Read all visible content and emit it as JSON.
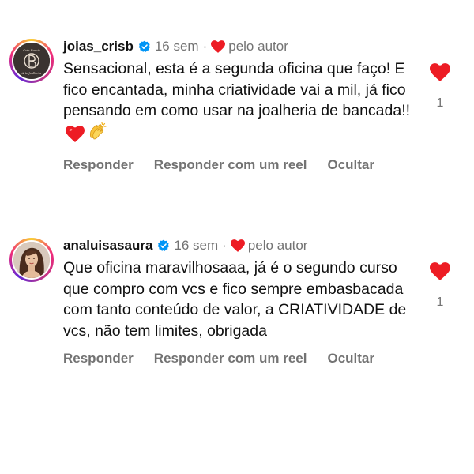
{
  "comments": [
    {
      "username": "joias_crisb",
      "time": "16 sem",
      "separator": "·",
      "liked_by": "pelo autor",
      "text": "Sensacional, esta é a segunda oficina que faço! E fico encantada, minha criatividade vai a mil, já fico pensando em como usar na joalheria de bancada!!",
      "actions": {
        "reply": "Responder",
        "reply_reel": "Responder com um reel",
        "hide": "Ocultar"
      },
      "likes": "1",
      "avatar_logo_text": {
        "top": "Cris Bosch",
        "bottom": "Arte Joalheira"
      }
    },
    {
      "username": "analuisasaura",
      "time": "16 sem",
      "separator": "·",
      "liked_by": "pelo autor",
      "text": "Que oficina maravilhosaaa, já é o segundo curso que compro com vcs e fico sempre embasbacada com tanto conteúdo de valor, a CRIATIVIDADE de vcs, não tem limites, obrigada",
      "actions": {
        "reply": "Responder",
        "reply_reel": "Responder com um reel",
        "hide": "Ocultar"
      },
      "likes": "1"
    }
  ],
  "colors": {
    "heart": "#ed1c24",
    "verified": "#0095f6",
    "meta": "#737373"
  },
  "icons": [
    "verified-badge-icon",
    "heart-icon",
    "clapping-hands-icon"
  ]
}
